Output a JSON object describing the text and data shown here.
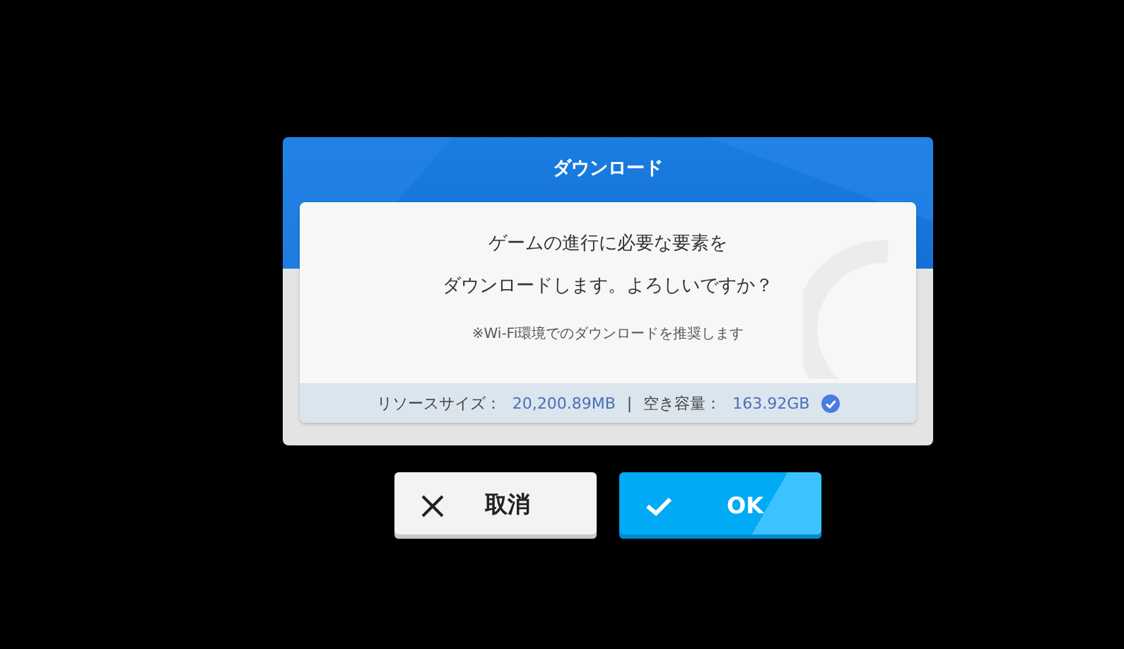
{
  "dialog": {
    "title": "ダウンロード",
    "message_lines": [
      "ゲームの進行に必要な要素を",
      "ダウンロードします。よろしいですか？"
    ],
    "note": "※Wi-Fi環境でのダウンロードを推奨します",
    "info": {
      "resource_label": "リソースサイズ：",
      "resource_value": "20,200.89MB",
      "separator": "|",
      "free_label": "空き容量：",
      "free_value": "163.92GB"
    }
  },
  "buttons": [
    {
      "kind": "cancel",
      "label": "取消"
    },
    {
      "kind": "ok",
      "label": "OK"
    }
  ]
}
